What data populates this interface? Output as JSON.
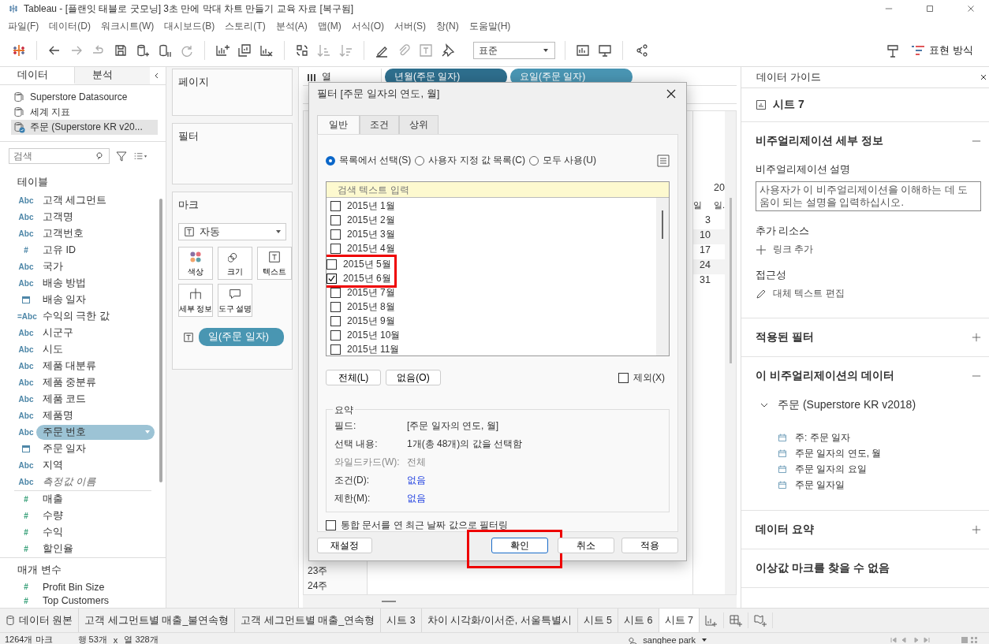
{
  "window": {
    "title": "Tableau - [플랜잇 태블로 굿모닝] 3초 만에 막대 차트 만들기 교육 자료 [복구됨]"
  },
  "menu": [
    "파일(F)",
    "데이터(D)",
    "워크시트(W)",
    "대시보드(B)",
    "스토리(T)",
    "분석(A)",
    "맵(M)",
    "서식(O)",
    "서버(S)",
    "창(N)",
    "도움말(H)"
  ],
  "toolbar": {
    "fit_dropdown": "표준",
    "show_me": "표현 방식"
  },
  "left_panel": {
    "tabs": [
      {
        "label": "데이터",
        "selected": true
      },
      {
        "label": "분석",
        "selected": false
      }
    ],
    "data_sources": [
      {
        "name": "Superstore Datasource",
        "selected": false
      },
      {
        "name": "세계 지표",
        "selected": false
      },
      {
        "name": "주문 (Superstore KR v20...",
        "selected": true
      }
    ],
    "search": {
      "placeholder": "검색"
    },
    "tables_heading": "테이블",
    "fields": [
      {
        "kind": "field",
        "badge": "Abc",
        "name": "고객 세그먼트",
        "selected": false,
        "color": "#4e87a8"
      },
      {
        "kind": "field",
        "badge": "Abc",
        "name": "고객명",
        "selected": false,
        "color": "#4e87a8"
      },
      {
        "kind": "field",
        "badge": "Abc",
        "name": "고객번호",
        "selected": false,
        "color": "#4e87a8"
      },
      {
        "kind": "field",
        "badge": "#",
        "name": "고유 ID",
        "selected": false,
        "color": "#4e87a8"
      },
      {
        "kind": "field",
        "badge": "Abc",
        "name": "국가",
        "selected": false,
        "color": "#4e87a8"
      },
      {
        "kind": "field",
        "badge": "Abc",
        "name": "배송 방법",
        "selected": false,
        "color": "#4e87a8"
      },
      {
        "kind": "date",
        "name": "배송 일자",
        "selected": false,
        "color": "#4e87a8"
      },
      {
        "kind": "field",
        "badge": "=Abc",
        "name": "수익의 극한 값",
        "selected": false,
        "color": "#4e87a8"
      },
      {
        "kind": "field",
        "badge": "Abc",
        "name": "시군구",
        "selected": false,
        "color": "#4e87a8"
      },
      {
        "kind": "field",
        "badge": "Abc",
        "name": "시도",
        "selected": false,
        "color": "#4e87a8"
      },
      {
        "kind": "field",
        "badge": "Abc",
        "name": "제품 대분류",
        "selected": false,
        "color": "#4e87a8"
      },
      {
        "kind": "field",
        "badge": "Abc",
        "name": "제품 중분류",
        "selected": false,
        "color": "#4e87a8"
      },
      {
        "kind": "field",
        "badge": "Abc",
        "name": "제품 코드",
        "selected": false,
        "color": "#4e87a8"
      },
      {
        "kind": "field",
        "badge": "Abc",
        "name": "제품명",
        "selected": false,
        "color": "#4e87a8"
      },
      {
        "kind": "field",
        "badge": "Abc",
        "name": "주문 번호",
        "selected": true,
        "color": "#4e87a8"
      },
      {
        "kind": "date",
        "name": "주문 일자",
        "selected": false,
        "color": "#4e87a8"
      },
      {
        "kind": "field",
        "badge": "Abc",
        "name": "지역",
        "selected": false,
        "color": "#4e87a8"
      },
      {
        "kind": "generated",
        "badge": "Abc",
        "name": "측정값 이름",
        "selected": false,
        "color": "#4e87a8"
      }
    ],
    "measures": [
      {
        "badge": "#",
        "name": "매출",
        "color": "#3aa17a"
      },
      {
        "badge": "#",
        "name": "수량",
        "color": "#3aa17a"
      },
      {
        "badge": "#",
        "name": "수익",
        "color": "#3aa17a"
      },
      {
        "badge": "#",
        "name": "할인율",
        "color": "#3aa17a"
      }
    ],
    "parameters_heading": "매개 변수",
    "parameters": [
      {
        "badge": "#",
        "name": "Profit Bin Size",
        "color": "#3aa17a"
      },
      {
        "badge": "#",
        "name": "Top Customers",
        "color": "#3aa17a"
      }
    ]
  },
  "shelves": {
    "pages": "페이지",
    "filters": "필터",
    "marks": {
      "title": "마크",
      "type": "자동",
      "buttons": [
        {
          "kind": "color",
          "label": "색상"
        },
        {
          "kind": "size",
          "label": "크기"
        },
        {
          "kind": "text",
          "label": "텍스트"
        },
        {
          "kind": "detail",
          "label": "세부 정보"
        },
        {
          "kind": "tooltip",
          "label": "도구 설명"
        }
      ],
      "pills": [
        "일(주문 일자)"
      ]
    }
  },
  "canvas": {
    "columns_label": "열",
    "column_pills": [
      "년월(주문 일자)",
      "요일(주문 일자)"
    ],
    "header": "20",
    "subheaders": [
      "일",
      "일."
    ],
    "values": [
      "3",
      "10",
      "17",
      "24",
      "31"
    ],
    "row_labels": [
      "23주",
      "24주"
    ]
  },
  "filter_dialog": {
    "title": "필터 [주문 일자의 연도, 월]",
    "tabs": [
      {
        "label": "일반",
        "selected": true
      },
      {
        "label": "조건",
        "selected": false
      },
      {
        "label": "상위",
        "selected": false
      }
    ],
    "modes": [
      {
        "label": "목록에서 선택(S)",
        "selected": true
      },
      {
        "label": "사용자 지정 값 목록(C)",
        "selected": false
      },
      {
        "label": "모두 사용(U)",
        "selected": false
      }
    ],
    "search": {
      "placeholder": "검색 텍스트 입력"
    },
    "items": [
      {
        "label": "2015년 1월",
        "checked": false,
        "highlighted": false
      },
      {
        "label": "2015년 2월",
        "checked": false,
        "highlighted": false
      },
      {
        "label": "2015년 3월",
        "checked": false,
        "highlighted": false
      },
      {
        "label": "2015년 4월",
        "checked": false,
        "highlighted": false
      },
      {
        "label": "2015년 5월",
        "checked": false,
        "highlighted": true
      },
      {
        "label": "2015년 6월",
        "checked": true,
        "highlighted": true
      },
      {
        "label": "2015년 7월",
        "checked": false,
        "highlighted": false
      },
      {
        "label": "2015년 8월",
        "checked": false,
        "highlighted": false
      },
      {
        "label": "2015년 9월",
        "checked": false,
        "highlighted": false
      },
      {
        "label": "2015년 10월",
        "checked": false,
        "highlighted": false
      },
      {
        "label": "2015년 11월",
        "checked": false,
        "highlighted": false
      }
    ],
    "select_buttons": [
      "전체(L)",
      "없음(O)"
    ],
    "exclude": {
      "label": "제외(X)",
      "checked": false
    },
    "summary": {
      "title": "요약",
      "rows": [
        {
          "label": "필드:",
          "value": "[주문 일자의 연도, 월]",
          "kind": "plain"
        },
        {
          "label": "선택 내용:",
          "value": "1개(총 48개)의 값을 선택함",
          "kind": "plain"
        },
        {
          "label": "와일드카드(W):",
          "value": "전체",
          "kind": "disabled"
        },
        {
          "label": "조건(D):",
          "value": "없음",
          "kind": "link"
        },
        {
          "label": "제한(M):",
          "value": "없음",
          "kind": "link"
        }
      ]
    },
    "latest_date": {
      "label": "통합 문서를 연 최근 날짜 값으로 필터링",
      "checked": false
    },
    "reset": "재설정",
    "buttons": [
      {
        "label": "확인",
        "default": true,
        "highlighted": true
      },
      {
        "label": "취소",
        "default": false,
        "highlighted": false
      },
      {
        "label": "적용",
        "default": false,
        "highlighted": false
      }
    ]
  },
  "data_guide": {
    "title": "데이터 가이드",
    "sheet": "시트 7",
    "sections": [
      {
        "kind": "details",
        "title": "비주얼리제이션 세부 정보",
        "expanded": true,
        "description_label": "비주얼리제이션 설명",
        "description_placeholder": "사용자가 이 비주얼리제이션을 이해하는 데 도움이 되는 설명을 입력하십시오.",
        "resources_label": "추가 리소스",
        "add_link": "링크 추가",
        "accessibility_label": "접근성",
        "alt_text": "대체 텍스트 편집"
      },
      {
        "kind": "plain",
        "title": "적용된 필터",
        "expanded": false
      },
      {
        "kind": "data",
        "title": "이 비주얼리제이션의 데이터",
        "expanded": true,
        "source": "주문 (Superstore KR v2018)",
        "fields": [
          "주: 주문 일자",
          "주문 일자의 연도, 월",
          "주문 일자의 요일",
          "주문 일자일"
        ]
      },
      {
        "kind": "plain",
        "title": "데이터 요약",
        "expanded": false
      },
      {
        "kind": "note",
        "title": "이상값 마크를 찾을 수 없음"
      }
    ]
  },
  "sheet_tabs": [
    {
      "kind": "datasource",
      "label": "데이터 원본",
      "selected": false
    },
    {
      "kind": "sheet",
      "label": "고객 세그먼트별 매출_불연속형",
      "selected": false
    },
    {
      "kind": "sheet",
      "label": "고객 세그먼트별 매출_연속형",
      "selected": false
    },
    {
      "kind": "sheet",
      "label": "시트 3",
      "selected": false
    },
    {
      "kind": "sheet",
      "label": "차이 시각화/이서준, 서울특별시",
      "selected": false
    },
    {
      "kind": "sheet",
      "label": "시트 5",
      "selected": false
    },
    {
      "kind": "sheet",
      "label": "시트 6",
      "selected": false
    },
    {
      "kind": "sheet",
      "label": "시트 7",
      "selected": true
    }
  ],
  "status_bar": {
    "marks": "1264개 마크",
    "rows": "행 53개",
    "times": "x",
    "columns": "열 328개",
    "user": "sanghee park"
  }
}
